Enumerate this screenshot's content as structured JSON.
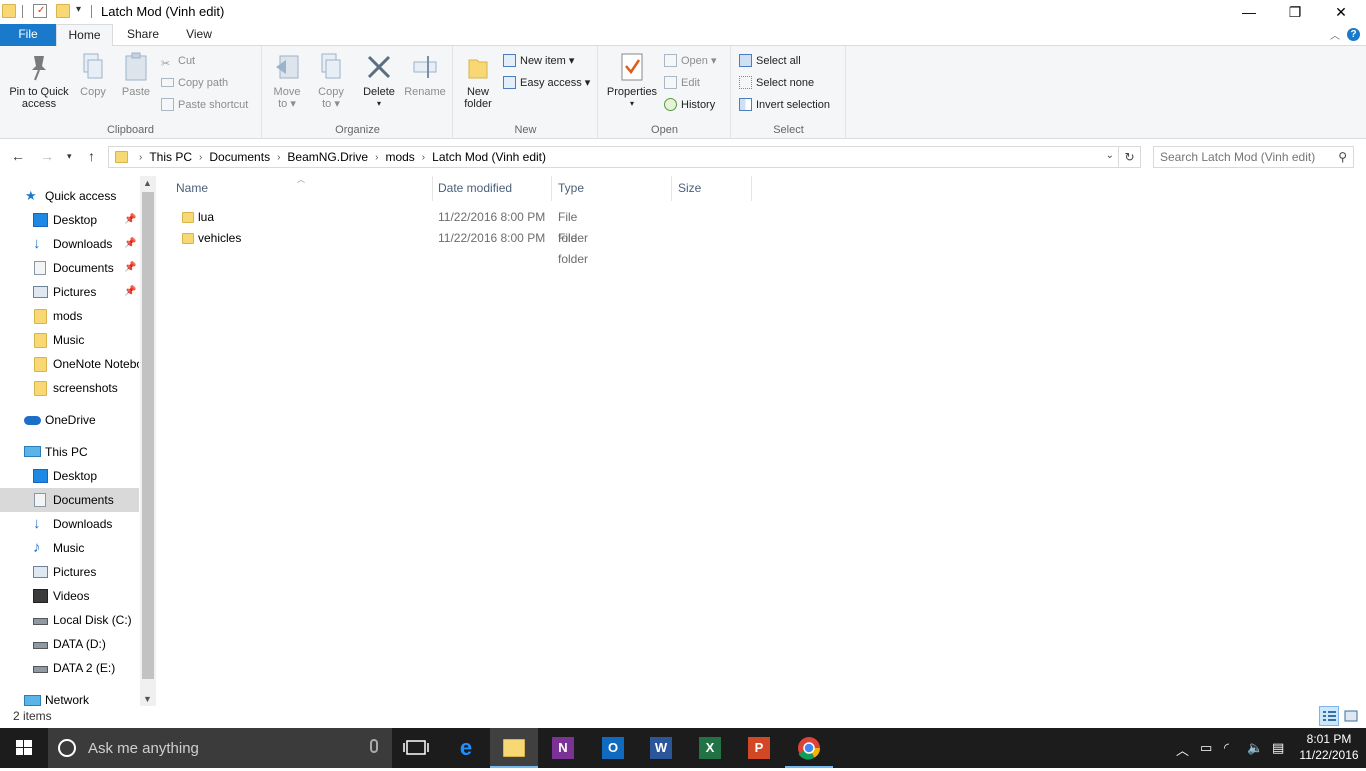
{
  "window": {
    "title": "Latch Mod (Vinh edit)",
    "controls": {
      "minimize": "—",
      "maximize": "❐",
      "close": "✕"
    }
  },
  "ribbon": {
    "tabs": [
      "File",
      "Home",
      "Share",
      "View"
    ],
    "clipboard": {
      "label": "Clipboard",
      "pin": [
        "Pin to Quick",
        "access"
      ],
      "copy": "Copy",
      "paste": "Paste",
      "cut": "Cut",
      "copy_path": "Copy path",
      "paste_shortcut": "Paste shortcut"
    },
    "organize": {
      "label": "Organize",
      "move_to": [
        "Move",
        "to ▾"
      ],
      "copy_to": [
        "Copy",
        "to ▾"
      ],
      "delete": [
        "Delete",
        "▾"
      ],
      "rename": "Rename"
    },
    "new": {
      "label": "New",
      "new_folder": [
        "New",
        "folder"
      ],
      "new_item": "New item ▾",
      "easy_access": "Easy access ▾"
    },
    "open": {
      "label": "Open",
      "properties": [
        "Properties",
        "▾"
      ],
      "open": "Open ▾",
      "edit": "Edit",
      "history": "History"
    },
    "select": {
      "label": "Select",
      "select_all": "Select all",
      "select_none": "Select none",
      "invert": "Invert selection"
    }
  },
  "address": {
    "crumbs": [
      "This PC",
      "Documents",
      "BeamNG.Drive",
      "mods",
      "Latch Mod (Vinh edit)"
    ],
    "search_placeholder": "Search Latch Mod (Vinh edit)"
  },
  "navpane": {
    "quick_access": "Quick access",
    "quick_items": [
      {
        "label": "Desktop",
        "pinned": true
      },
      {
        "label": "Downloads",
        "pinned": true
      },
      {
        "label": "Documents",
        "pinned": true
      },
      {
        "label": "Pictures",
        "pinned": true
      },
      {
        "label": "mods",
        "pinned": false
      },
      {
        "label": "Music",
        "pinned": false
      },
      {
        "label": "OneNote Notebooks",
        "pinned": false
      },
      {
        "label": "screenshots",
        "pinned": false
      }
    ],
    "onedrive": "OneDrive",
    "this_pc": "This PC",
    "pc_items": [
      "Desktop",
      "Documents",
      "Downloads",
      "Music",
      "Pictures",
      "Videos",
      "Local Disk (C:)",
      "DATA (D:)",
      "DATA 2 (E:)"
    ],
    "selected": "Documents",
    "network": "Network"
  },
  "filelist": {
    "columns": [
      "Name",
      "Date modified",
      "Type",
      "Size"
    ],
    "rows": [
      {
        "name": "lua",
        "date": "11/22/2016 8:00 PM",
        "type": "File folder",
        "size": ""
      },
      {
        "name": "vehicles",
        "date": "11/22/2016 8:00 PM",
        "type": "File folder",
        "size": ""
      }
    ]
  },
  "status": {
    "count": "2 items"
  },
  "taskbar": {
    "search_text": "Ask me anything",
    "time": "8:01 PM",
    "date": "11/22/2016"
  }
}
